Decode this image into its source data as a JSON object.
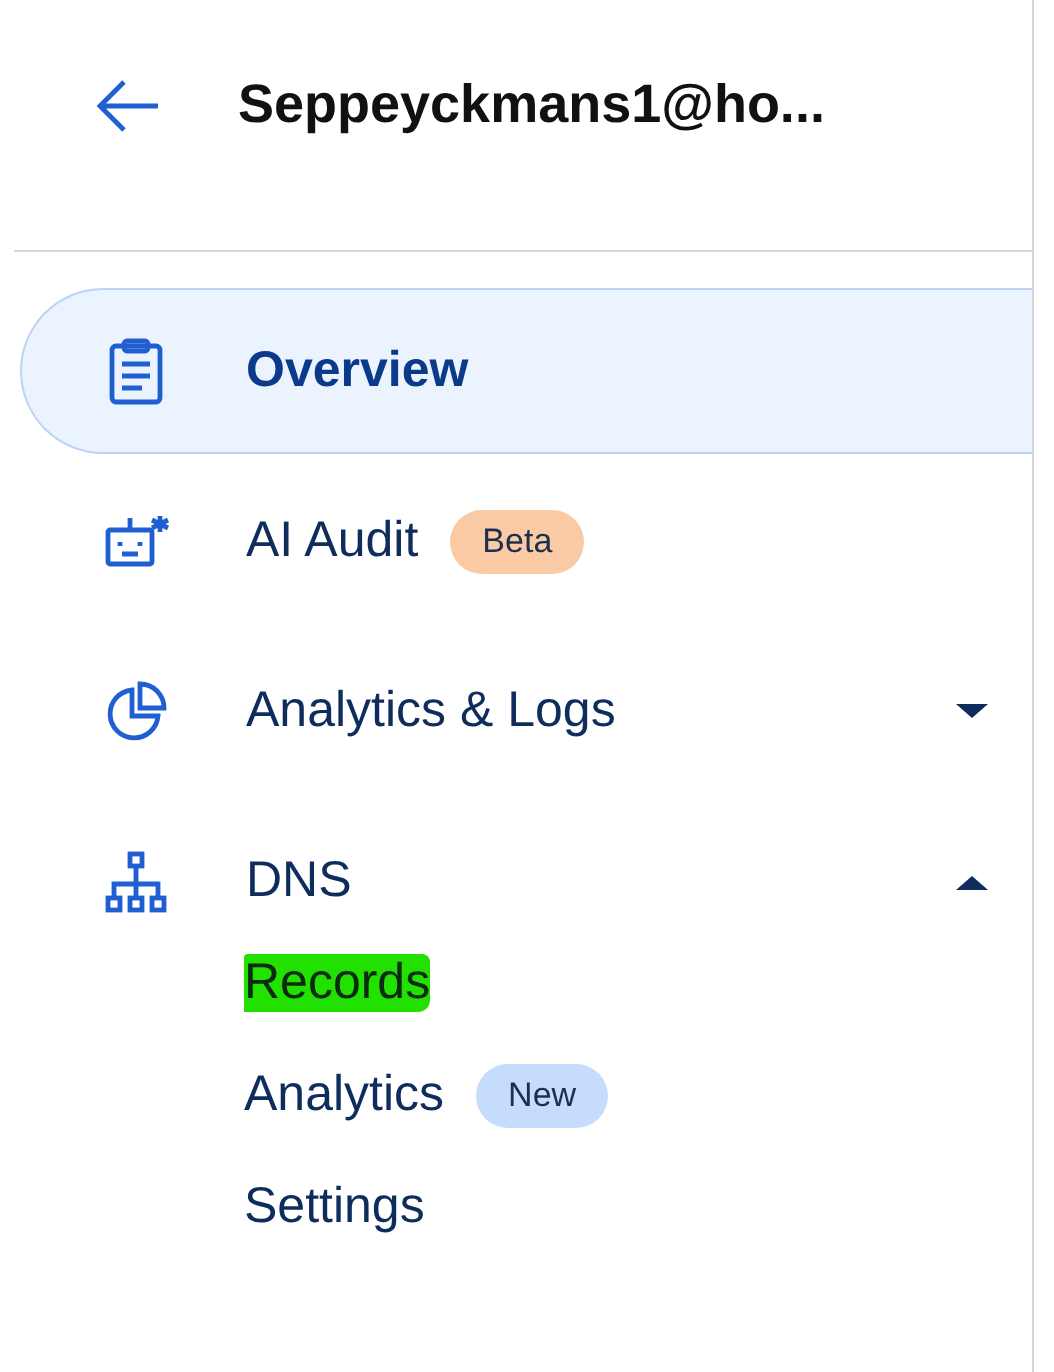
{
  "header": {
    "title": "Seppeyckmans1@ho..."
  },
  "nav": [
    {
      "label": "Overview",
      "selected": true
    },
    {
      "label": "AI Audit",
      "selected": false,
      "badge": {
        "text": "Beta",
        "color": "#f9caa3"
      }
    },
    {
      "label": "Analytics & Logs",
      "selected": false,
      "expanded": false
    },
    {
      "label": "DNS",
      "selected": false,
      "expanded": true,
      "children": [
        {
          "label": "Records",
          "highlighted": true
        },
        {
          "label": "Analytics",
          "highlighted": false,
          "badge": {
            "text": "New",
            "color": "#c5dcfc"
          }
        },
        {
          "label": "Settings",
          "highlighted": false
        }
      ]
    }
  ]
}
